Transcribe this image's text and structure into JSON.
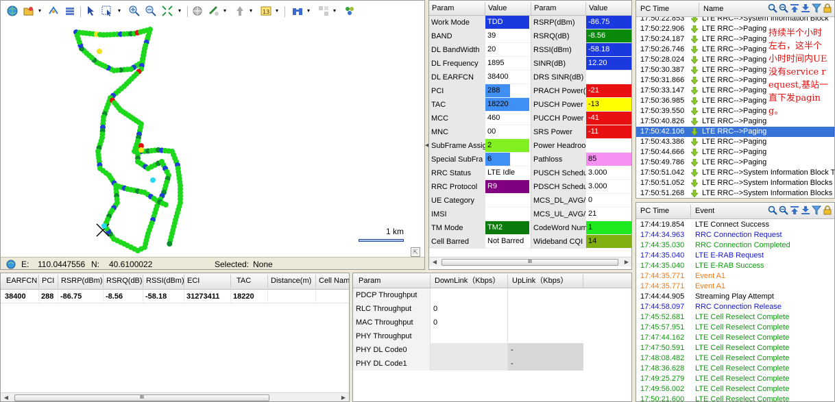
{
  "map": {
    "toolbar": {
      "icons": [
        "globe-icon",
        "folder-open-icon",
        "dropdown-icon",
        "layers-icon",
        "database-icon",
        "pointer-icon",
        "select-region-icon",
        "dropdown-icon",
        "zoom-in-icon",
        "zoom-out-icon",
        "zoom-extent-icon",
        "dropdown-icon",
        "pan-icon",
        "measure-icon",
        "ruler-icon",
        "dropdown-icon",
        "label-icon",
        "dropdown-icon",
        "binoculars-icon",
        "dropdown-icon",
        "grid-icon",
        "dropdown-icon",
        "cells-icon"
      ]
    },
    "scale_label": "1 km",
    "status": {
      "e_label": "E:",
      "e_value": "110.0447556",
      "n_label": "N:",
      "n_value": "40.6100022",
      "selected_label": "Selected:",
      "selected_value": "None"
    },
    "colors": {
      "good": "#1ed81e",
      "mid": "#1f3fd6",
      "fair": "#0a8c2e",
      "warn": "#f0e020",
      "bad": "#e01010",
      "cyan": "#28d8f0"
    }
  },
  "params": {
    "headers": [
      "Param",
      "Value",
      "Param",
      "Value"
    ],
    "rows": [
      {
        "p1": "Work Mode",
        "v1": "TDD",
        "c1": "#1a3ae0",
        "p2": "RSRP(dBm)",
        "v2": "-86.75",
        "c2": "#1a3ae0"
      },
      {
        "p1": "BAND",
        "v1": "39",
        "c1": "",
        "p2": "RSRQ(dB)",
        "v2": "-8.56",
        "c2": "#0a8a0a"
      },
      {
        "p1": "DL BandWidth",
        "v1": "20",
        "c1": "",
        "p2": "RSSI(dBm)",
        "v2": "-58.18",
        "c2": "#1a3ae0"
      },
      {
        "p1": "DL Frequency",
        "v1": "1895",
        "c1": "",
        "p2": "SINR(dB)",
        "v2": "12.20",
        "c2": "#1a3ae0"
      },
      {
        "p1": "DL EARFCN",
        "v1": "38400",
        "c1": "",
        "p2": "DRS SINR(dB)",
        "v2": "",
        "c2": ""
      },
      {
        "p1": "PCI",
        "v1": "288",
        "c1": "#3f8ff5",
        "p2": "PRACH Power(",
        "v2": "-21",
        "c2": "#e81010"
      },
      {
        "p1": "TAC",
        "v1": "18220",
        "c1": "#3f8ff5",
        "p2": "PUSCH Power",
        "v2": "-13",
        "c2": "#ffff00"
      },
      {
        "p1": "MCC",
        "v1": "460",
        "c1": "",
        "p2": "PUCCH Power",
        "v2": "-41",
        "c2": "#e81010"
      },
      {
        "p1": "MNC",
        "v1": "00",
        "c1": "",
        "p2": "SRS Power",
        "v2": "-11",
        "c2": "#e81010"
      },
      {
        "p1": "SubFrame Assig",
        "v1": "2",
        "c1": "#80f020",
        "p2": "Power Headroo",
        "v2": "",
        "c2": ""
      },
      {
        "p1": "Special SubFra",
        "v1": "6",
        "c1": "#3f8ff5",
        "p2": "Pathloss",
        "v2": "85",
        "c2": "#f590f0"
      },
      {
        "p1": "RRC Status",
        "v1": "LTE Idle",
        "c1": "",
        "p2": "PUSCH Schedul",
        "v2": "3.000",
        "c2": ""
      },
      {
        "p1": "RRC Protocol",
        "v1": "R9",
        "c1": "#800080",
        "p2": "PDSCH Schedul",
        "v2": "3.000",
        "c2": ""
      },
      {
        "p1": "UE Category",
        "v1": "",
        "c1": "",
        "p2": "MCS_DL_AVG/",
        "v2": "0",
        "c2": ""
      },
      {
        "p1": "IMSI",
        "v1": "",
        "c1": "",
        "p2": "MCS_UL_AVG/",
        "v2": "21",
        "c2": ""
      },
      {
        "p1": "TM Mode",
        "v1": "TM2",
        "c1": "#0a7a0a",
        "p2": "CodeWord Num",
        "v2": "1",
        "c2": "#1ee81e"
      },
      {
        "p1": "Cell Barred",
        "v1": "Not Barred",
        "c1": "",
        "p2": "Wideband CQI",
        "v2": "14",
        "c2": "#80b010"
      }
    ]
  },
  "messages": {
    "headers": [
      "PC Time",
      "Name"
    ],
    "rows": [
      {
        "time": "17:50:22.853",
        "name": "LTE RRC-->System Information Block",
        "selected": false
      },
      {
        "time": "17:50:22.906",
        "name": "LTE RRC-->Paging",
        "selected": false
      },
      {
        "time": "17:50:24.187",
        "name": "LTE RRC-->Paging",
        "selected": false
      },
      {
        "time": "17:50:26.746",
        "name": "LTE RRC-->Paging",
        "selected": false
      },
      {
        "time": "17:50:28.024",
        "name": "LTE RRC-->Paging",
        "selected": false
      },
      {
        "time": "17:50:30.387",
        "name": "LTE RRC-->Paging",
        "selected": false
      },
      {
        "time": "17:50:31.866",
        "name": "LTE RRC-->Paging",
        "selected": false
      },
      {
        "time": "17:50:33.147",
        "name": "LTE RRC-->Paging",
        "selected": false
      },
      {
        "time": "17:50:36.985",
        "name": "LTE RRC-->Paging",
        "selected": false
      },
      {
        "time": "17:50:39.550",
        "name": "LTE RRC-->Paging",
        "selected": false
      },
      {
        "time": "17:50:40.826",
        "name": "LTE RRC-->Paging",
        "selected": false
      },
      {
        "time": "17:50:42.106",
        "name": "LTE RRC-->Paging",
        "selected": true
      },
      {
        "time": "17:50:43.386",
        "name": "LTE RRC-->Paging",
        "selected": false
      },
      {
        "time": "17:50:44.666",
        "name": "LTE RRC-->Paging",
        "selected": false
      },
      {
        "time": "17:50:49.786",
        "name": "LTE RRC-->Paging",
        "selected": false
      },
      {
        "time": "17:50:51.042",
        "name": "LTE RRC-->System Information Block T",
        "selected": false
      },
      {
        "time": "17:50:51.052",
        "name": "LTE RRC-->System Information Blocks",
        "selected": false
      },
      {
        "time": "17:50:51.268",
        "name": "LTE RRC-->System Information Blocks",
        "selected": false
      }
    ],
    "toolbar_icons": [
      "search-icon",
      "search-next-icon",
      "move-up-icon",
      "move-down-icon",
      "filter-icon",
      "lock-icon"
    ],
    "annotation": "持续半个小时左右，这半个小时时间内UE没有service request,基站一直下发paging。"
  },
  "events": {
    "headers": [
      "PC Time",
      "Event"
    ],
    "toolbar_icons": [
      "search-icon",
      "search-next-icon",
      "move-up-icon",
      "move-down-icon",
      "filter-icon",
      "lock-icon"
    ],
    "rows": [
      {
        "time": "17:44:19.854",
        "event": "LTE Connect Success",
        "color": "#000000"
      },
      {
        "time": "17:44:34.963",
        "event": "RRC Connection Request",
        "color": "#1414d0"
      },
      {
        "time": "17:44:35.030",
        "event": "RRC Connection Completed",
        "color": "#0a9a0a"
      },
      {
        "time": "17:44:35.040",
        "event": "LTE E-RAB Request",
        "color": "#1414d0"
      },
      {
        "time": "17:44:35.040",
        "event": "LTE E-RAB Success",
        "color": "#0a9a0a"
      },
      {
        "time": "17:44:35.771",
        "event": "Event A1",
        "color": "#f07810"
      },
      {
        "time": "17:44:35.771",
        "event": "Event A1",
        "color": "#f07810"
      },
      {
        "time": "17:44:44.905",
        "event": "Streaming Play Attempt",
        "color": "#000000"
      },
      {
        "time": "17:44:58.097",
        "event": "RRC Connection Release",
        "color": "#1414d0"
      },
      {
        "time": "17:45:52.681",
        "event": "LTE Cell Reselect Complete",
        "color": "#0a9a0a"
      },
      {
        "time": "17:45:57.951",
        "event": "LTE Cell Reselect Complete",
        "color": "#0a9a0a"
      },
      {
        "time": "17:47:44.162",
        "event": "LTE Cell Reselect Complete",
        "color": "#0a9a0a"
      },
      {
        "time": "17:47:50.591",
        "event": "LTE Cell Reselect Complete",
        "color": "#0a9a0a"
      },
      {
        "time": "17:48:08.482",
        "event": "LTE Cell Reselect Complete",
        "color": "#0a9a0a"
      },
      {
        "time": "17:48:36.628",
        "event": "LTE Cell Reselect Complete",
        "color": "#0a9a0a"
      },
      {
        "time": "17:49:25.279",
        "event": "LTE Cell Reselect Complete",
        "color": "#0a9a0a"
      },
      {
        "time": "17:49:56.002",
        "event": "LTE Cell Reselect Complete",
        "color": "#0a9a0a"
      },
      {
        "time": "17:50:21.600",
        "event": "LTE Cell Reselect Complete",
        "color": "#0a9a0a"
      }
    ]
  },
  "cells": {
    "headers": [
      "EARFCN",
      "PCI",
      "RSRP(dBm)",
      "RSRQ(dB)",
      "RSSI(dBm)",
      "ECI",
      "TAC",
      "Distance(m)",
      "Cell Name"
    ],
    "rows": [
      {
        "earfcn": "38400",
        "pci": "288",
        "rsrp": "-86.75",
        "rsrq": "-8.56",
        "rssi": "-58.18",
        "eci": "31273411",
        "tac": "18220",
        "distance": "",
        "cell_name": ""
      }
    ]
  },
  "throughput": {
    "headers": [
      "Param",
      "DownLink（Kbps）",
      "UpLink（Kbps）"
    ],
    "rows": [
      {
        "param": "PDCP Throughput",
        "dl": "",
        "ul": "",
        "grey": false
      },
      {
        "param": "RLC Throughput",
        "dl": "0",
        "ul": "",
        "grey": false
      },
      {
        "param": "MAC Throughput",
        "dl": "0",
        "ul": "",
        "grey": false
      },
      {
        "param": "PHY Throughput",
        "dl": "",
        "ul": "",
        "grey": false
      },
      {
        "param": "PHY DL Code0",
        "dl": "",
        "ul": "-",
        "grey": true
      },
      {
        "param": "PHY DL Code1",
        "dl": "",
        "ul": "-",
        "grey": true
      }
    ]
  },
  "scroll_grip": "III",
  "scroll_arrow_left": "◀",
  "scroll_arrow_right": "▶",
  "splitter_arrow": "◀"
}
